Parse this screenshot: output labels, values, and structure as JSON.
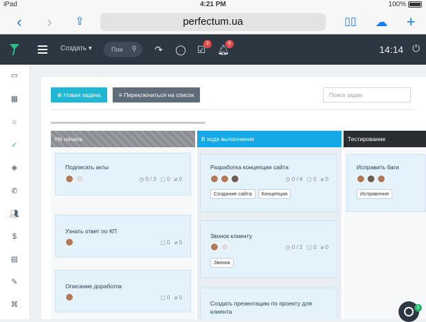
{
  "status_bar": {
    "device": "iPad",
    "wifi_icon": "wifi-icon",
    "time": "4:21 PM",
    "battery": "100%"
  },
  "browser": {
    "url": "perfectum.ua"
  },
  "app_bar": {
    "create_label": "Создать",
    "search_placeholder": "Пои",
    "tasks_badge": "3",
    "notifications_badge": "6",
    "clock": "14:14"
  },
  "toolbar": {
    "new_task_label": "Новая задача",
    "switch_list_label": "Переключиться на список",
    "task_search_placeholder": "Поиск задач"
  },
  "columns": [
    {
      "title": "Не начата",
      "cards": [
        {
          "title": "Подписать акты",
          "checks": "0 / 3",
          "comments": "0",
          "attachments": "0"
        },
        {
          "title": "Узнать ответ по КП",
          "comments": "0",
          "attachments": "0"
        },
        {
          "title": "Описание доработок",
          "comments": "0",
          "attachments": "0"
        }
      ]
    },
    {
      "title": "В ходе выполнения",
      "cards": [
        {
          "title": "Разработка концепции сайта",
          "checks": "0 / 4",
          "comments": "0",
          "attachments": "0",
          "tags": [
            "Создание сайта",
            "Концепция"
          ]
        },
        {
          "title": "Звонок клиенту",
          "checks": "0 / 2",
          "comments": "0",
          "attachments": "0",
          "tags": [
            "Звонок"
          ]
        },
        {
          "title": "Создать презентацию по проекту для клиента"
        }
      ]
    },
    {
      "title": "Тестирование",
      "cards": [
        {
          "title": "Исправить баги",
          "tags": [
            "Исправлние"
          ]
        }
      ]
    }
  ],
  "help_badge": "0",
  "colors": {
    "accent": "#1fb7d4",
    "topbar": "#2d3742",
    "in_progress": "#14a9e6"
  }
}
